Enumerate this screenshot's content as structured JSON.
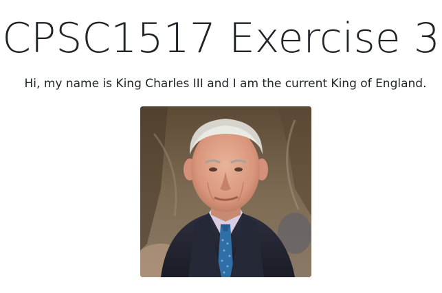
{
  "page": {
    "title": "CPSC1517 Exercise 3",
    "intro": "Hi, my name is King Charles III and I am the current King of England."
  },
  "portrait": {
    "subject": "King Charles III portrait photo"
  },
  "colors": {
    "text": "#212529",
    "background": "#ffffff"
  }
}
